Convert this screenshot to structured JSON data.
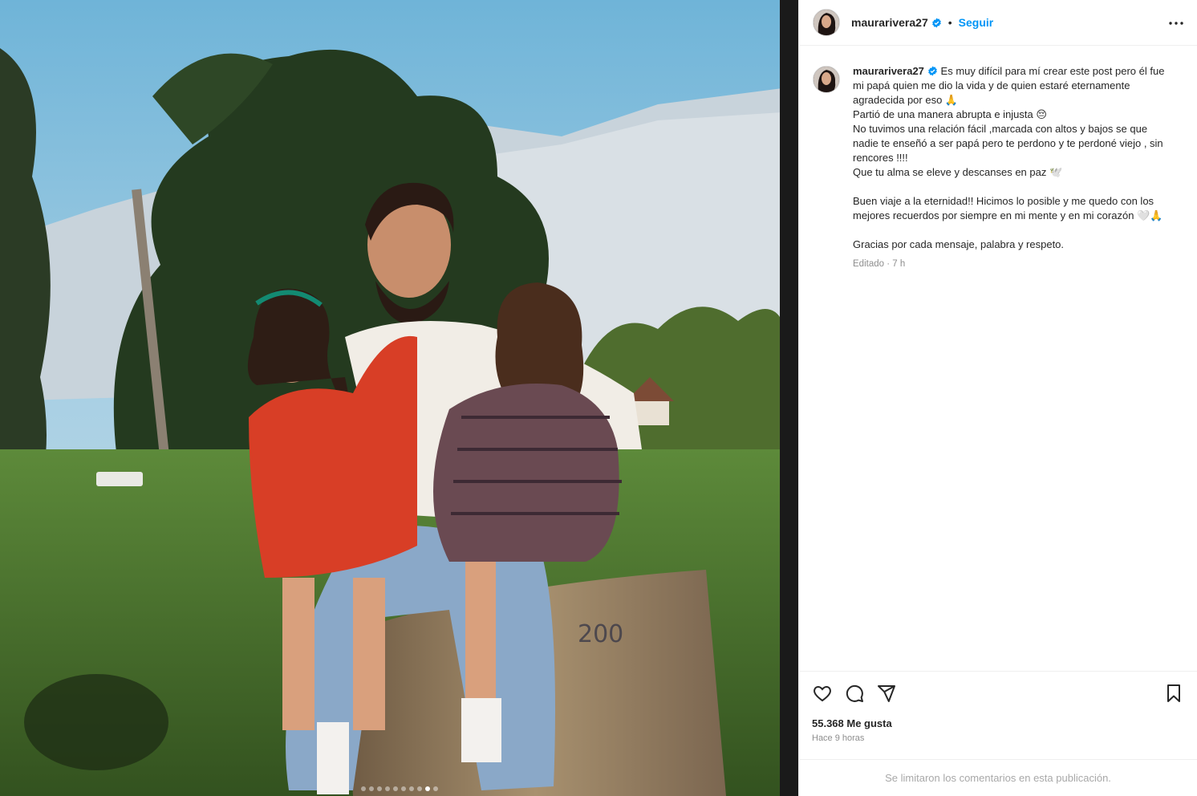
{
  "post": {
    "username": "maurarivera27",
    "follow_label": "Seguir",
    "separator": "•",
    "more_icon": "more-horizontal-icon",
    "verified_icon": "verified-badge-icon",
    "caption": {
      "line_1_rest": "Es muy difícil para mí crear este post pero él fue",
      "line_2": "mi papá quien me dio la vida y de quien estaré eternamente",
      "line_3": "agradecida por eso 🙏",
      "line_4": "Partió de una manera abrupta e injusta 😔",
      "line_5": "No tuvimos una relación fácil ,marcada con altos y bajos se que",
      "line_6": "nadie te enseñó a ser papá pero te perdono y te perdoné viejo , sin",
      "line_7": "rencores !!!!",
      "line_8": "Que tu alma se eleve y descanses en paz 🕊️",
      "line_9": "Buen viaje a la eternidad!! Hicimos lo posible y me quedo con los",
      "line_10": "mejores recuerdos por siempre en mi mente y en mi corazón 🤍🙏",
      "line_11": "Gracias por cada mensaje, palabra y respeto."
    },
    "edited_meta": "Editado · 7 h",
    "likes": "55.368 Me gusta",
    "time_ago": "Hace 9 horas",
    "comments_limited": "Se limitaron los comentarios en esta publicación.",
    "icons": {
      "like": "heart-icon",
      "comment": "comment-icon",
      "share": "share-icon",
      "save": "bookmark-icon"
    },
    "carousel": {
      "total": 10,
      "active_index": 8
    }
  },
  "colors": {
    "accent_blue": "#0095f6",
    "verified": "#0095f6",
    "text": "#262626",
    "muted": "#8e8e8e",
    "border": "#efefef"
  }
}
